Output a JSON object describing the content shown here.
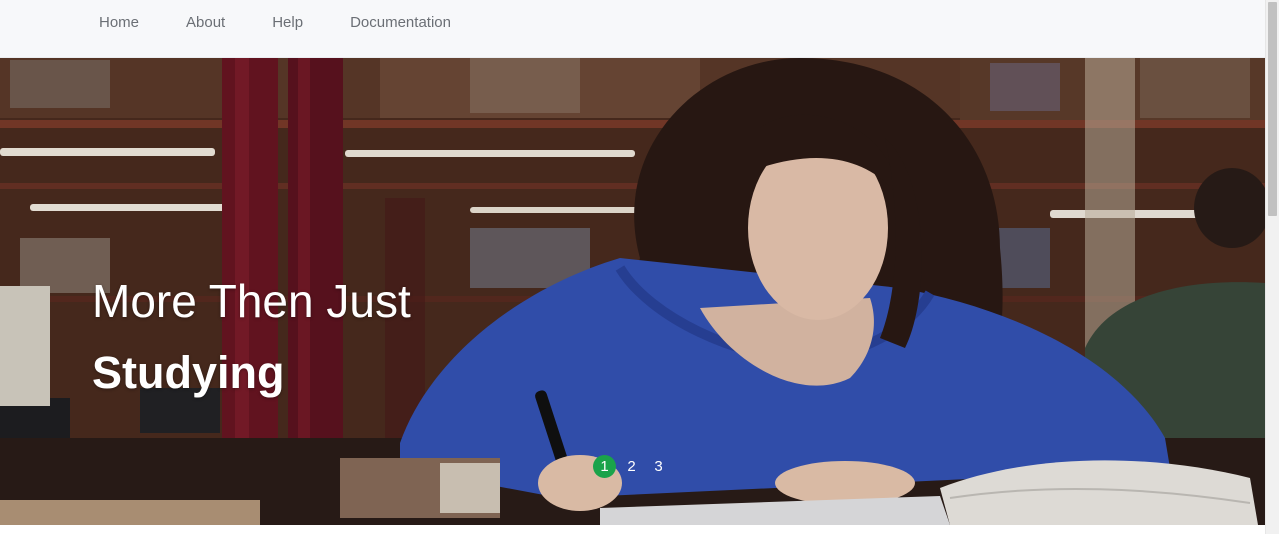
{
  "nav": {
    "items": [
      {
        "label": "Home"
      },
      {
        "label": "About"
      },
      {
        "label": "Help"
      },
      {
        "label": "Documentation"
      }
    ]
  },
  "hero": {
    "title_line1": "More Then Just",
    "title_line2": "Studying"
  },
  "slider": {
    "pages": [
      "1",
      "2",
      "3"
    ],
    "active": 1,
    "active_color": "#1aa34a"
  }
}
